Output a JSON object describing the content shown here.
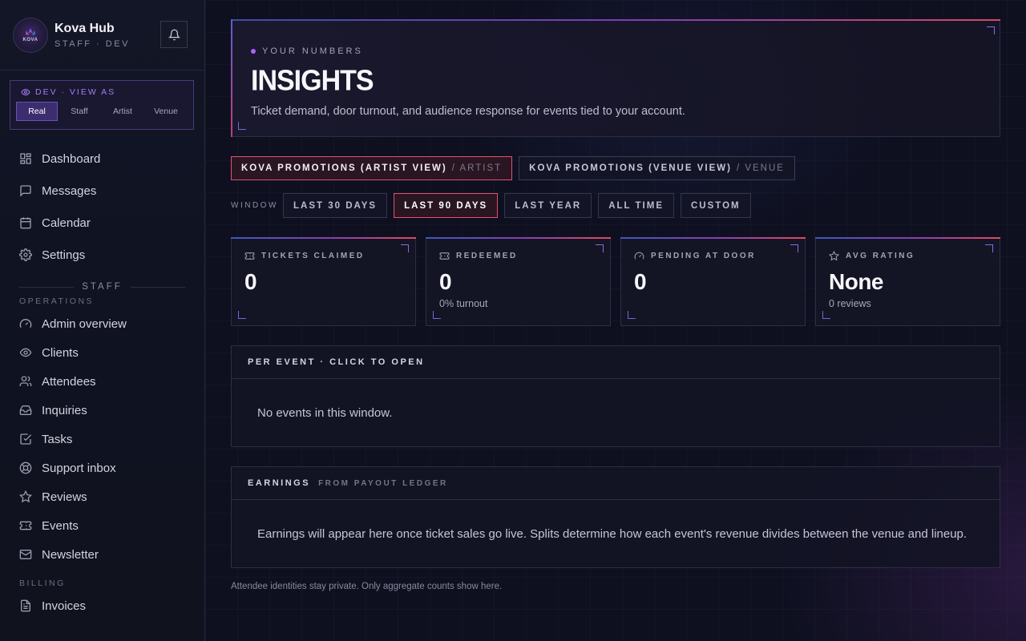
{
  "brand": {
    "title": "Kova Hub",
    "subtitle": "STAFF · DEV",
    "logo_text": "KOVA"
  },
  "view_as": {
    "label": "DEV · VIEW AS",
    "options": [
      "Real",
      "Staff",
      "Artist",
      "Venue"
    ],
    "selected": "Real"
  },
  "nav_main": [
    {
      "label": "Dashboard",
      "icon": "dashboard-icon"
    },
    {
      "label": "Messages",
      "icon": "message-icon"
    },
    {
      "label": "Calendar",
      "icon": "calendar-icon"
    },
    {
      "label": "Settings",
      "icon": "gear-icon"
    }
  ],
  "staff_divider": "STAFF",
  "operations_label": "OPERATIONS",
  "nav_operations": [
    {
      "label": "Admin overview",
      "icon": "gauge-icon"
    },
    {
      "label": "Clients",
      "icon": "eye-icon"
    },
    {
      "label": "Attendees",
      "icon": "users-icon"
    },
    {
      "label": "Inquiries",
      "icon": "inbox-icon"
    },
    {
      "label": "Tasks",
      "icon": "checkbox-icon"
    },
    {
      "label": "Support inbox",
      "icon": "lifebuoy-icon"
    },
    {
      "label": "Reviews",
      "icon": "star-icon"
    },
    {
      "label": "Events",
      "icon": "ticket-icon"
    },
    {
      "label": "Newsletter",
      "icon": "mail-icon"
    }
  ],
  "billing_label": "BILLING",
  "nav_billing": [
    {
      "label": "Invoices",
      "icon": "document-icon"
    }
  ],
  "hero": {
    "eyebrow": "YOUR NUMBERS",
    "title": "INSIGHTS",
    "description": "Ticket demand, door turnout, and audience response for events tied to your account."
  },
  "accounts": [
    {
      "name": "KOVA PROMOTIONS (ARTIST VIEW)",
      "role": "/ ARTIST",
      "active": true
    },
    {
      "name": "KOVA PROMOTIONS (VENUE VIEW)",
      "role": "/ VENUE",
      "active": false
    }
  ],
  "window": {
    "label": "WINDOW",
    "options": [
      "LAST 30 DAYS",
      "LAST 90 DAYS",
      "LAST YEAR",
      "ALL TIME",
      "CUSTOM"
    ],
    "selected": "LAST 90 DAYS"
  },
  "stats": [
    {
      "label": "TICKETS CLAIMED",
      "value": "0",
      "sub": "",
      "icon": "ticket-icon"
    },
    {
      "label": "REDEEMED",
      "value": "0",
      "sub": "0% turnout",
      "icon": "ticket-icon"
    },
    {
      "label": "PENDING AT DOOR",
      "value": "0",
      "sub": "",
      "icon": "gauge-icon"
    },
    {
      "label": "AVG RATING",
      "value": "None",
      "sub": "0 reviews",
      "icon": "star-icon"
    }
  ],
  "per_event": {
    "title": "PER EVENT · CLICK TO OPEN",
    "empty": "No events in this window."
  },
  "earnings": {
    "title": "EARNINGS",
    "subtitle": "FROM PAYOUT LEDGER",
    "body": "Earnings will appear here once ticket sales go live. Splits determine how each event's revenue divides between the venue and lineup."
  },
  "footnote": "Attendee identities stay private. Only aggregate counts show here.",
  "colors": {
    "accent_purple": "#a963ff",
    "accent_red": "#e0526a",
    "background": "#0e1020"
  }
}
